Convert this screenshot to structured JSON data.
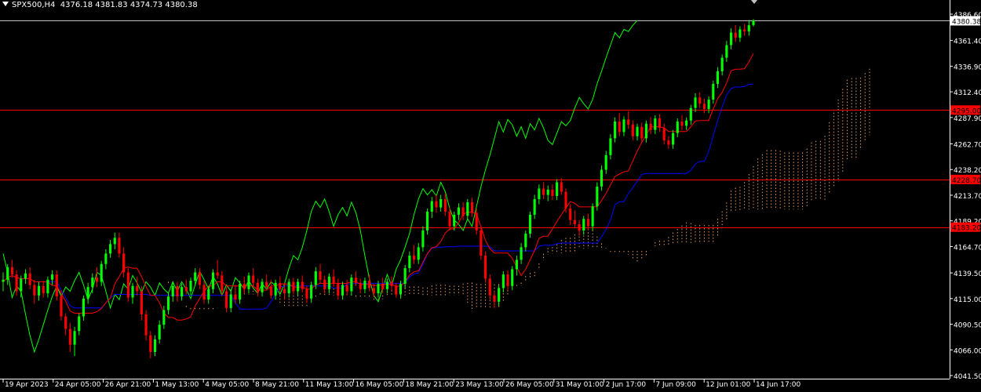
{
  "header": {
    "symbol": "SPX500,H4",
    "ohlc": "4376.18 4381.83 4374.73 4380.38"
  },
  "chart_data": {
    "type": "candlestick",
    "symbol": "SPX500",
    "timeframe": "H4",
    "ylim": [
      4041.5,
      4386.6
    ],
    "y_ticks": [
      "4386.60",
      "4361.40",
      "4336.90",
      "4312.40",
      "4287.90",
      "4262.70",
      "4238.20",
      "4213.70",
      "4189.20",
      "4164.70",
      "4139.50",
      "4115.00",
      "4090.50",
      "4066.00",
      "4041.50"
    ],
    "x_ticks": [
      "19 Apr 2023",
      "24 Apr 05:00",
      "26 Apr 21:00",
      "1 May 13:00",
      "4 May 05:00",
      "8 May 21:00",
      "11 May 13:00",
      "16 May 05:00",
      "18 May 21:00",
      "23 May 13:00",
      "26 May 05:00",
      "31 May 01:00",
      "2 Jun 17:00",
      "7 Jun 09:00",
      "12 Jun 01:00",
      "14 Jun 17:00"
    ],
    "levels": [
      {
        "value": 4295.0,
        "label": "4295.00",
        "color": "#ff0000"
      },
      {
        "value": 4228.7,
        "label": "4228.70",
        "color": "#ff0000"
      },
      {
        "value": 4183.2,
        "label": "4183.20",
        "color": "#ff0000"
      }
    ],
    "current_price": {
      "value": 4380.38,
      "label": "4380.38"
    },
    "colors": {
      "bull": "#00ff00",
      "bear": "#ff0000",
      "tenkan": "#ff0000",
      "kijun": "#0000ff",
      "chikou": "#00ff00",
      "cloud": "#f4a460",
      "background": "#000000"
    },
    "candles": [
      [
        4131.0,
        4140.0,
        4122.0,
        4133.0
      ],
      [
        4133.0,
        4148.0,
        4128.0,
        4145.0
      ],
      [
        4145.0,
        4152.0,
        4135.0,
        4138.0
      ],
      [
        4138.0,
        4142.0,
        4118.0,
        4122.0
      ],
      [
        4122.0,
        4137.0,
        4116.0,
        4134.0
      ],
      [
        4134.0,
        4143.0,
        4129.0,
        4139.0
      ],
      [
        4139.0,
        4145.0,
        4124.0,
        4128.0
      ],
      [
        4128.0,
        4133.0,
        4110.0,
        4118.0
      ],
      [
        4118.0,
        4131.0,
        4113.0,
        4127.0
      ],
      [
        4127.0,
        4132.0,
        4116.0,
        4120.0
      ],
      [
        4120.0,
        4136.0,
        4116.0,
        4133.0
      ],
      [
        4133.0,
        4142.0,
        4128.0,
        4138.0
      ],
      [
        4138.0,
        4142.0,
        4113.0,
        4117.0
      ],
      [
        4117.0,
        4123.0,
        4094.0,
        4098.0
      ],
      [
        4098.0,
        4101.0,
        4080.0,
        4086.0
      ],
      [
        4086.0,
        4092.0,
        4064.0,
        4071.0
      ],
      [
        4071.0,
        4088.0,
        4060.0,
        4084.0
      ],
      [
        4084.0,
        4101.0,
        4080.0,
        4098.0
      ],
      [
        4098.0,
        4118.0,
        4094.0,
        4115.0
      ],
      [
        4115.0,
        4130.0,
        4110.0,
        4126.0
      ],
      [
        4126.0,
        4139.0,
        4120.0,
        4135.0
      ],
      [
        4135.0,
        4145.0,
        4126.0,
        4131.0
      ],
      [
        4131.0,
        4151.0,
        4127.0,
        4148.0
      ],
      [
        4148.0,
        4162.0,
        4143.0,
        4158.0
      ],
      [
        4158.0,
        4171.0,
        4154.0,
        4167.0
      ],
      [
        4167.0,
        4178.0,
        4162.0,
        4173.0
      ],
      [
        4173.0,
        4178.0,
        4154.0,
        4158.0
      ],
      [
        4158.0,
        4164.0,
        4135.0,
        4140.0
      ],
      [
        4140.0,
        4144.0,
        4112.0,
        4116.0
      ],
      [
        4116.0,
        4130.0,
        4110.0,
        4127.0
      ],
      [
        4127.0,
        4136.0,
        4118.0,
        4122.0
      ],
      [
        4122.0,
        4127.0,
        4094.0,
        4100.0
      ],
      [
        4100.0,
        4104.0,
        4075.0,
        4080.0
      ],
      [
        4080.0,
        4084.0,
        4058.0,
        4064.0
      ],
      [
        4064.0,
        4080.0,
        4060.0,
        4076.0
      ],
      [
        4076.0,
        4094.0,
        4072.0,
        4090.0
      ],
      [
        4090.0,
        4108.0,
        4086.0,
        4104.0
      ],
      [
        4104.0,
        4121.0,
        4100.0,
        4117.0
      ],
      [
        4117.0,
        4131.0,
        4112.0,
        4127.0
      ],
      [
        4127.0,
        4131.0,
        4112.0,
        4117.0
      ],
      [
        4117.0,
        4129.0,
        4113.0,
        4126.0
      ],
      [
        4126.0,
        4133.0,
        4119.0,
        4122.0
      ],
      [
        4122.0,
        4135.0,
        4118.0,
        4132.0
      ],
      [
        4132.0,
        4144.0,
        4128.0,
        4140.0
      ],
      [
        4140.0,
        4144.0,
        4124.0,
        4128.0
      ],
      [
        4128.0,
        4132.0,
        4110.0,
        4114.0
      ],
      [
        4114.0,
        4127.0,
        4110.0,
        4124.0
      ],
      [
        4124.0,
        4143.0,
        4120.0,
        4140.0
      ],
      [
        4140.0,
        4152.0,
        4134.0,
        4137.0
      ],
      [
        4137.0,
        4141.0,
        4118.0,
        4122.0
      ],
      [
        4122.0,
        4126.0,
        4102.0,
        4106.0
      ],
      [
        4106.0,
        4122.0,
        4102.0,
        4119.0
      ],
      [
        4119.0,
        4128.0,
        4110.0,
        4114.0
      ],
      [
        4114.0,
        4132.0,
        4110.0,
        4129.0
      ],
      [
        4129.0,
        4136.0,
        4120.0,
        4124.0
      ],
      [
        4124.0,
        4140.0,
        4120.0,
        4137.0
      ],
      [
        4137.0,
        4144.0,
        4126.0,
        4130.0
      ],
      [
        4130.0,
        4134.0,
        4117.0,
        4121.0
      ],
      [
        4121.0,
        4134.0,
        4117.0,
        4131.0
      ],
      [
        4131.0,
        4138.0,
        4124.0,
        4126.0
      ],
      [
        4126.0,
        4133.0,
        4115.0,
        4118.0
      ],
      [
        4118.0,
        4133.0,
        4114.0,
        4130.0
      ],
      [
        4130.0,
        4136.0,
        4121.0,
        4124.0
      ],
      [
        4124.0,
        4130.0,
        4114.0,
        4120.0
      ],
      [
        4120.0,
        4134.0,
        4116.0,
        4131.0
      ],
      [
        4131.0,
        4135.0,
        4119.0,
        4122.0
      ],
      [
        4122.0,
        4134.0,
        4118.0,
        4131.0
      ],
      [
        4131.0,
        4137.0,
        4121.0,
        4124.0
      ],
      [
        4124.0,
        4127.0,
        4111.0,
        4115.0
      ],
      [
        4115.0,
        4131.0,
        4111.0,
        4128.0
      ],
      [
        4128.0,
        4145.0,
        4124.0,
        4141.0
      ],
      [
        4141.0,
        4148.0,
        4129.0,
        4133.0
      ],
      [
        4133.0,
        4137.0,
        4120.0,
        4124.0
      ],
      [
        4124.0,
        4139.0,
        4120.0,
        4136.0
      ],
      [
        4136.0,
        4143.0,
        4126.0,
        4129.0
      ],
      [
        4129.0,
        4134.0,
        4114.0,
        4118.0
      ],
      [
        4118.0,
        4131.0,
        4114.0,
        4128.0
      ],
      [
        4128.0,
        4133.0,
        4118.0,
        4122.0
      ],
      [
        4122.0,
        4138.0,
        4118.0,
        4135.0
      ],
      [
        4135.0,
        4141.0,
        4127.0,
        4130.0
      ],
      [
        4130.0,
        4134.0,
        4120.0,
        4124.0
      ],
      [
        4124.0,
        4135.0,
        4120.0,
        4132.0
      ],
      [
        4132.0,
        4138.0,
        4122.0,
        4125.0
      ],
      [
        4125.0,
        4129.0,
        4116.0,
        4120.0
      ],
      [
        4120.0,
        4132.0,
        4116.0,
        4129.0
      ],
      [
        4129.0,
        4135.0,
        4120.0,
        4124.0
      ],
      [
        4124.0,
        4134.0,
        4120.0,
        4131.0
      ],
      [
        4131.0,
        4136.0,
        4123.0,
        4127.0
      ],
      [
        4127.0,
        4130.0,
        4116.0,
        4119.0
      ],
      [
        4119.0,
        4132.0,
        4115.0,
        4129.0
      ],
      [
        4129.0,
        4147.0,
        4125.0,
        4144.0
      ],
      [
        4144.0,
        4160.0,
        4140.0,
        4156.0
      ],
      [
        4156.0,
        4166.0,
        4148.0,
        4152.0
      ],
      [
        4152.0,
        4168.0,
        4148.0,
        4164.0
      ],
      [
        4164.0,
        4184.0,
        4160.0,
        4180.0
      ],
      [
        4180.0,
        4201.0,
        4176.0,
        4198.0
      ],
      [
        4198.0,
        4212.0,
        4192.0,
        4208.0
      ],
      [
        4208.0,
        4214.0,
        4197.0,
        4202.0
      ],
      [
        4202.0,
        4214.0,
        4198.0,
        4210.0
      ],
      [
        4210.0,
        4215.0,
        4194.0,
        4198.0
      ],
      [
        4198.0,
        4202.0,
        4180.0,
        4184.0
      ],
      [
        4184.0,
        4198.0,
        4180.0,
        4195.0
      ],
      [
        4195.0,
        4206.0,
        4190.0,
        4202.0
      ],
      [
        4202.0,
        4207.0,
        4190.0,
        4194.0
      ],
      [
        4194.0,
        4210.0,
        4190.0,
        4207.0
      ],
      [
        4207.0,
        4211.0,
        4193.0,
        4197.0
      ],
      [
        4197.0,
        4201.0,
        4176.0,
        4180.0
      ],
      [
        4180.0,
        4184.0,
        4152.0,
        4156.0
      ],
      [
        4156.0,
        4160.0,
        4130.0,
        4134.0
      ],
      [
        4134.0,
        4138.0,
        4114.0,
        4118.0
      ],
      [
        4118.0,
        4122.0,
        4106.0,
        4112.0
      ],
      [
        4112.0,
        4128.0,
        4108.0,
        4125.0
      ],
      [
        4125.0,
        4141.0,
        4121.0,
        4138.0
      ],
      [
        4138.0,
        4142.0,
        4123.0,
        4127.0
      ],
      [
        4127.0,
        4146.0,
        4123.0,
        4143.0
      ],
      [
        4143.0,
        4156.0,
        4137.0,
        4152.0
      ],
      [
        4152.0,
        4168.0,
        4148.0,
        4164.0
      ],
      [
        4164.0,
        4180.0,
        4160.0,
        4177.0
      ],
      [
        4177.0,
        4198.0,
        4173.0,
        4195.0
      ],
      [
        4195.0,
        4214.0,
        4191.0,
        4210.0
      ],
      [
        4210.0,
        4224.0,
        4205.0,
        4220.0
      ],
      [
        4220.0,
        4226.0,
        4210.0,
        4214.0
      ],
      [
        4214.0,
        4223.0,
        4208.0,
        4219.0
      ],
      [
        4219.0,
        4224.0,
        4209.0,
        4213.0
      ],
      [
        4213.0,
        4229.0,
        4209.0,
        4226.0
      ],
      [
        4226.0,
        4230.0,
        4214.0,
        4217.0
      ],
      [
        4217.0,
        4220.0,
        4197.0,
        4201.0
      ],
      [
        4201.0,
        4205.0,
        4185.0,
        4190.0
      ],
      [
        4190.0,
        4199.0,
        4182.0,
        4186.0
      ],
      [
        4186.0,
        4190.0,
        4175.0,
        4180.0
      ],
      [
        4180.0,
        4194.0,
        4176.0,
        4191.0
      ],
      [
        4191.0,
        4196.0,
        4180.0,
        4184.0
      ],
      [
        4184.0,
        4206.0,
        4180.0,
        4203.0
      ],
      [
        4203.0,
        4226.0,
        4199.0,
        4222.0
      ],
      [
        4222.0,
        4242.0,
        4218.0,
        4238.0
      ],
      [
        4238.0,
        4256.0,
        4234.0,
        4252.0
      ],
      [
        4252.0,
        4272.0,
        4248.0,
        4268.0
      ],
      [
        4268.0,
        4288.0,
        4264.0,
        4284.0
      ],
      [
        4284.0,
        4292.0,
        4270.0,
        4274.0
      ],
      [
        4274.0,
        4289.0,
        4270.0,
        4286.0
      ],
      [
        4286.0,
        4294.0,
        4277.0,
        4281.0
      ],
      [
        4281.0,
        4285.0,
        4266.0,
        4270.0
      ],
      [
        4270.0,
        4282.0,
        4266.0,
        4279.0
      ],
      [
        4279.0,
        4283.0,
        4264.0,
        4268.0
      ],
      [
        4268.0,
        4285.0,
        4264.0,
        4282.0
      ],
      [
        4282.0,
        4288.0,
        4272.0,
        4276.0
      ],
      [
        4276.0,
        4290.0,
        4272.0,
        4287.0
      ],
      [
        4287.0,
        4291.0,
        4274.0,
        4278.0
      ],
      [
        4278.0,
        4282.0,
        4262.0,
        4266.0
      ],
      [
        4266.0,
        4270.0,
        4258.0,
        4262.0
      ],
      [
        4262.0,
        4276.0,
        4258.0,
        4273.0
      ],
      [
        4273.0,
        4287.0,
        4269.0,
        4284.0
      ],
      [
        4284.0,
        4290.0,
        4276.0,
        4280.0
      ],
      [
        4280.0,
        4288.0,
        4276.0,
        4285.0
      ],
      [
        4285.0,
        4300.0,
        4281.0,
        4297.0
      ],
      [
        4297.0,
        4311.0,
        4293.0,
        4307.0
      ],
      [
        4307.0,
        4312.0,
        4297.0,
        4301.0
      ],
      [
        4301.0,
        4306.0,
        4292.0,
        4296.0
      ],
      [
        4296.0,
        4308.0,
        4292.0,
        4305.0
      ],
      [
        4305.0,
        4323.0,
        4301.0,
        4320.0
      ],
      [
        4320.0,
        4336.0,
        4316.0,
        4332.0
      ],
      [
        4332.0,
        4348.0,
        4328.0,
        4345.0
      ],
      [
        4345.0,
        4361.0,
        4341.0,
        4357.0
      ],
      [
        4357.0,
        4373.0,
        4353.0,
        4369.0
      ],
      [
        4369.0,
        4376.0,
        4360.0,
        4364.0
      ],
      [
        4364.0,
        4375.0,
        4360.0,
        4372.0
      ],
      [
        4372.0,
        4377.0,
        4366.0,
        4370.0
      ],
      [
        4370.0,
        4381.0,
        4366.0,
        4376.0
      ],
      [
        4376.18,
        4381.83,
        4374.73,
        4380.38
      ]
    ]
  }
}
